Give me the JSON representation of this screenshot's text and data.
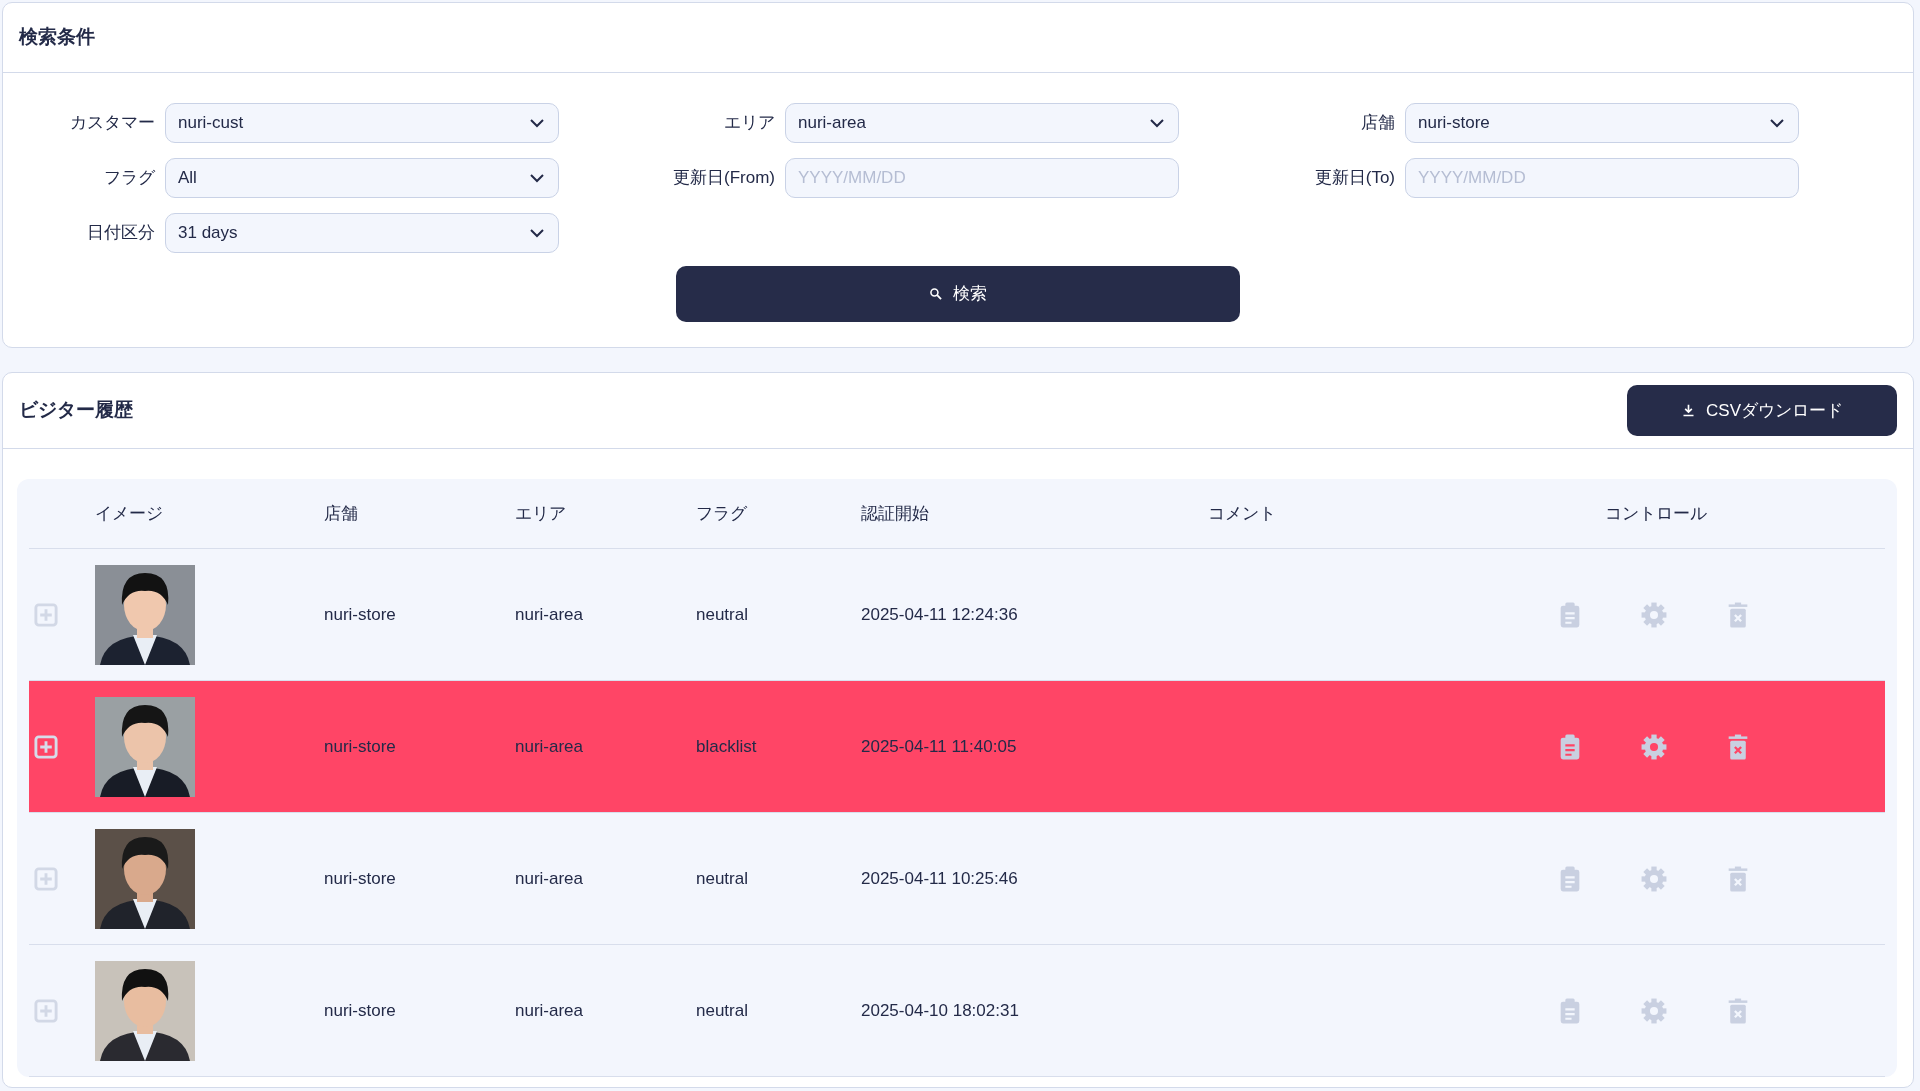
{
  "search_panel": {
    "title": "検索条件",
    "fields": [
      {
        "kind": "select",
        "label": "カスタマー",
        "value": "nuri-cust"
      },
      {
        "kind": "select",
        "label": "エリア",
        "value": "nuri-area"
      },
      {
        "kind": "select",
        "label": "店舗",
        "value": "nuri-store"
      },
      {
        "kind": "select",
        "label": "フラグ",
        "value": "All"
      },
      {
        "kind": "input",
        "label": "更新日(From)",
        "placeholder": "YYYY/MM/DD"
      },
      {
        "kind": "input",
        "label": "更新日(To)",
        "placeholder": "YYYY/MM/DD"
      },
      {
        "kind": "select",
        "label": "日付区分",
        "value": "31 days"
      }
    ],
    "button": "検索"
  },
  "history": {
    "title": "ビジター履歴",
    "csv_button": "CSVダウンロード",
    "columns": [
      "イメージ",
      "店舗",
      "エリア",
      "フラグ",
      "認証開始",
      "コメント",
      "コントロール"
    ],
    "rows": [
      {
        "store": "nuri-store",
        "area": "nuri-area",
        "flag": "neutral",
        "started": "2025-04-11 12:24:36",
        "highlighted": false
      },
      {
        "store": "nuri-store",
        "area": "nuri-area",
        "flag": "blacklist",
        "started": "2025-04-11 11:40:05",
        "highlighted": true
      },
      {
        "store": "nuri-store",
        "area": "nuri-area",
        "flag": "neutral",
        "started": "2025-04-11 10:25:46",
        "highlighted": false
      },
      {
        "store": "nuri-store",
        "area": "nuri-area",
        "flag": "neutral",
        "started": "2025-04-10 18:02:31",
        "highlighted": false
      }
    ]
  }
}
